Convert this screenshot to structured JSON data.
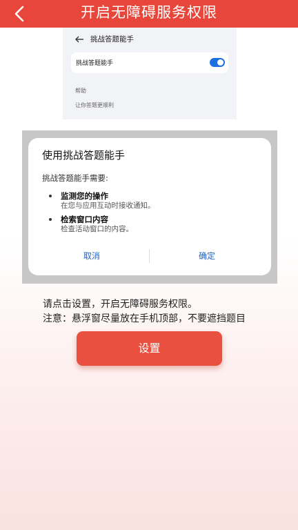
{
  "header": {
    "title": "开启无障碍服务权限"
  },
  "settings_preview": {
    "title": "挑战答题能手",
    "switch_label": "挑战答题能手",
    "switch_on": true,
    "help_label": "帮助",
    "help_desc": "让你答题更顺利"
  },
  "dialog_preview": {
    "title": "使用挑战答题能手",
    "intro": "挑战答题能手需要:",
    "permissions": [
      {
        "title": "监测您的操作",
        "desc": "在您与应用互动时接收通知。"
      },
      {
        "title": "检索窗口内容",
        "desc": "检查活动窗口的内容。"
      }
    ],
    "cancel_label": "取消",
    "confirm_label": "确定"
  },
  "instructions": {
    "line1": "请点击设置，开启无障碍服务权限。",
    "line2": "注意：悬浮窗尽量放在手机顶部，不要遮挡题目"
  },
  "main_button": {
    "label": "设置"
  },
  "colors": {
    "brand_red": "#e8463a",
    "button_red": "#e9503f",
    "toggle_blue": "#1e6fe0",
    "link_blue": "#1e63c9"
  }
}
